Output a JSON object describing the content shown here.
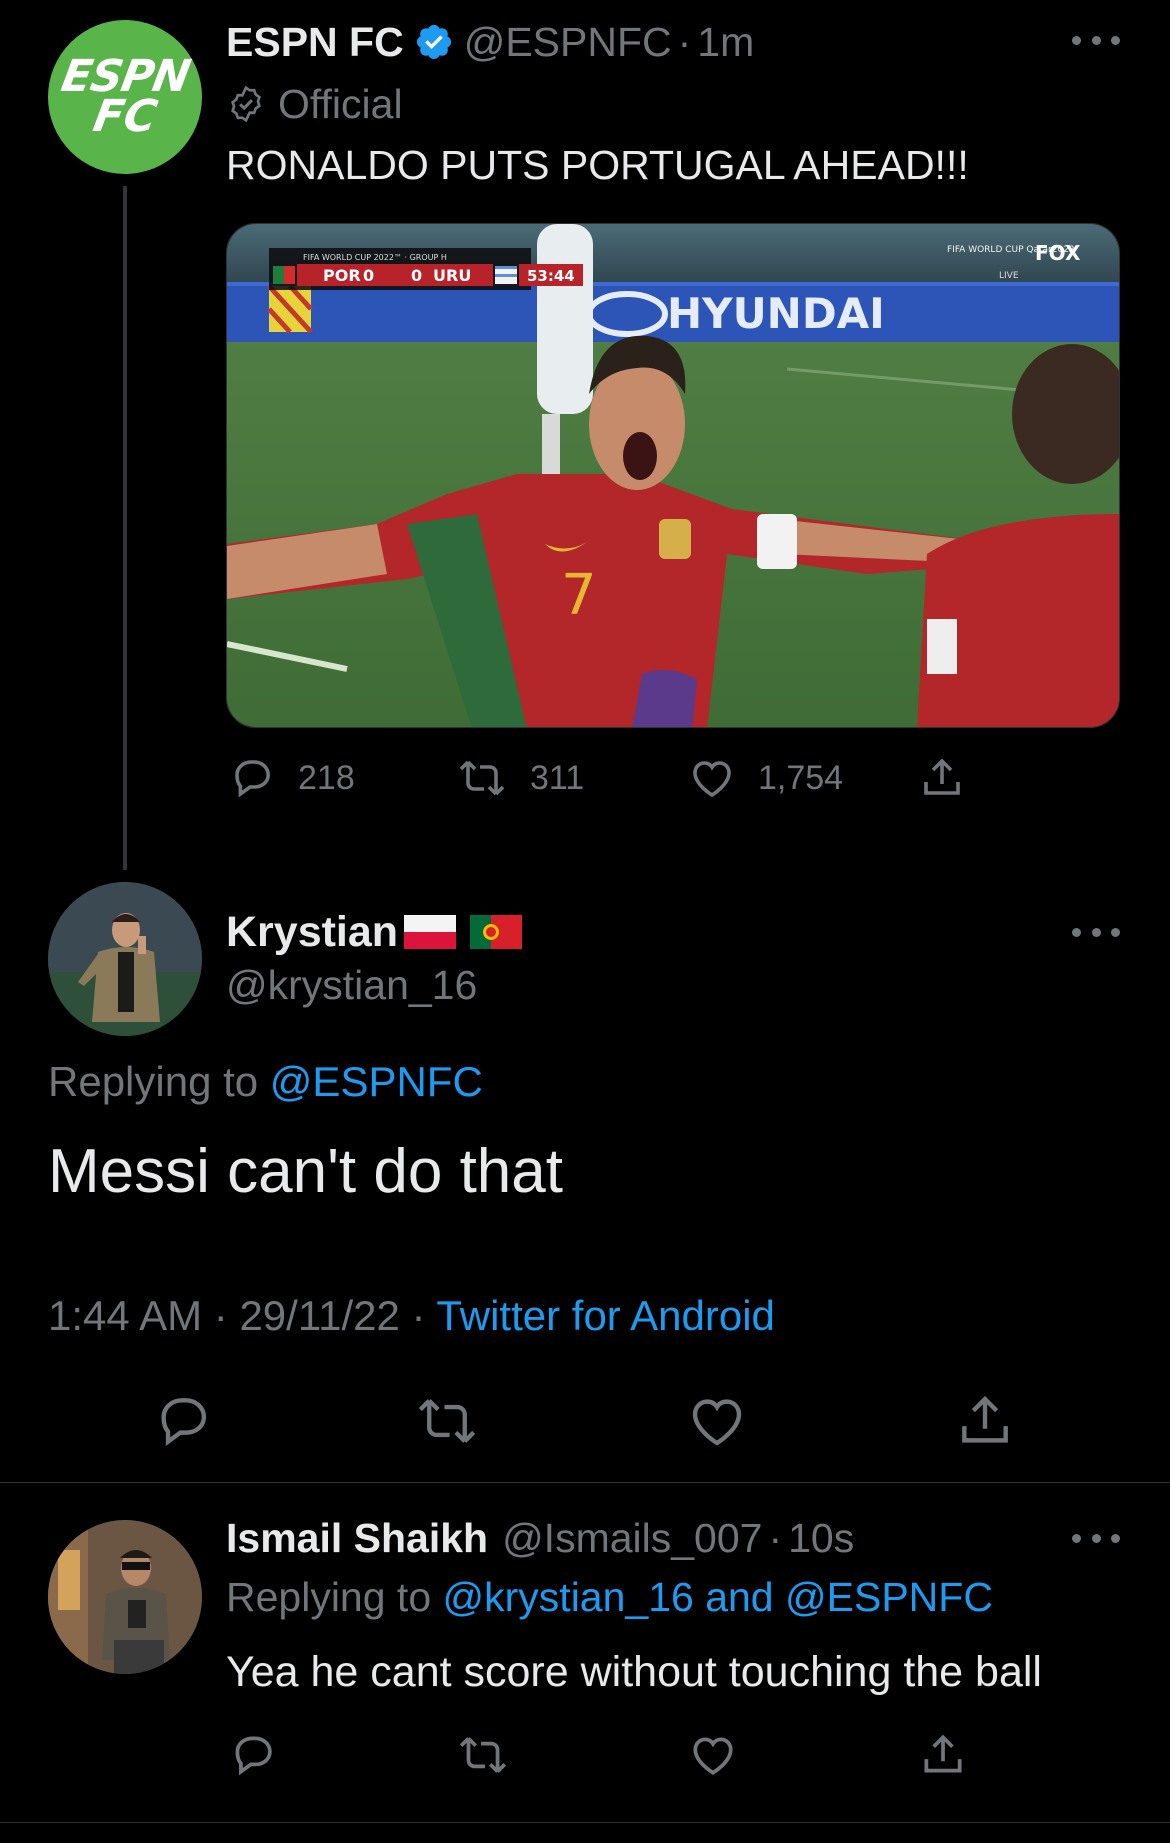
{
  "tweet1": {
    "author_name": "ESPN FC",
    "handle": "@ESPNFC",
    "time": "1m",
    "official_label": "Official",
    "text": "RONALDO PUTS PORTUGAL AHEAD!!!",
    "avatar_lines": [
      "ESPN",
      "FC"
    ],
    "media": {
      "scorebug_title": "FIFA WORLD CUP 2022™ · GROUP H",
      "team1": "POR",
      "score1": "0",
      "team2": "URU",
      "score2": "0",
      "clock": "53:44",
      "broadcaster": "FOX",
      "tournament_logo": "FIFA WORLD CUP Qatar2022",
      "live_label": "LIVE",
      "sponsor": "HYUNDAI",
      "jersey_number": "7"
    },
    "stats": {
      "replies": "218",
      "retweets": "311",
      "likes": "1,754"
    }
  },
  "tweet2": {
    "author_name": "Krystian",
    "flags": [
      "poland-flag",
      "portugal-flag"
    ],
    "handle": "@krystian_16",
    "replying_prefix": "Replying to",
    "replying_to": "@ESPNFC",
    "text": "Messi can't do that",
    "time": "1:44 AM",
    "date": "29/11/22",
    "source": "Twitter for Android"
  },
  "tweet3": {
    "author_name": "Ismail Shaikh",
    "handle": "@Ismails_007",
    "time": "10s",
    "replying_prefix": "Replying to",
    "replying_to": "@krystian_16 and @ESPNFC",
    "text": "Yea he cant score without touching the ball"
  },
  "separator": "·",
  "colors": {
    "background": "#000000",
    "text_primary": "#e7e9ea",
    "text_secondary": "#71767b",
    "accent": "#1d9bf0",
    "espn_green": "#59b54a"
  },
  "icons": [
    "verified-badge-icon",
    "official-check-icon",
    "more-icon",
    "reply-icon",
    "retweet-icon",
    "like-icon",
    "share-icon"
  ]
}
